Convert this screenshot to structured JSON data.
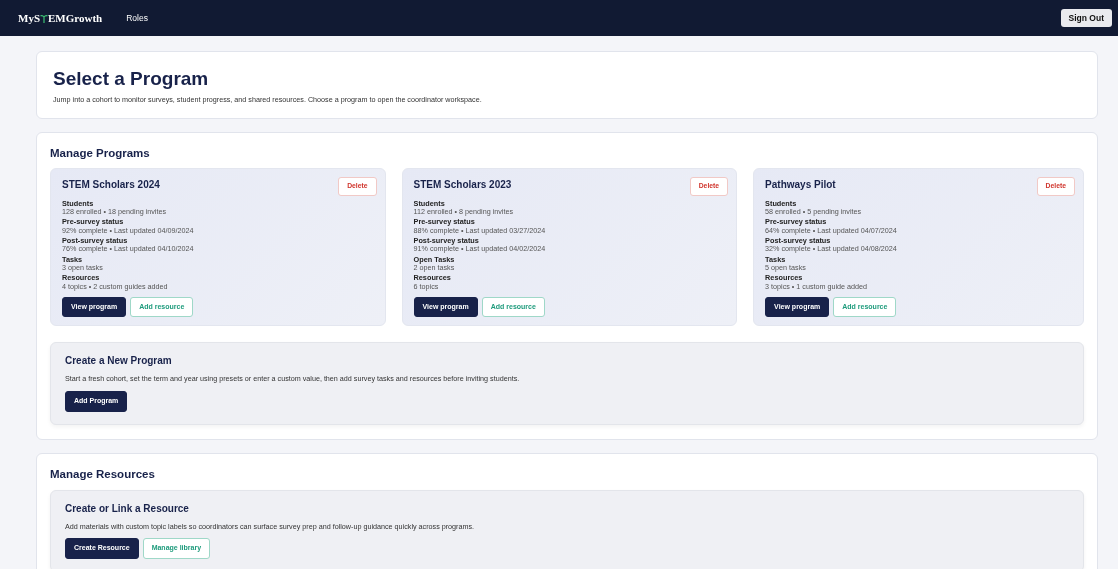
{
  "navbar": {
    "brand_start": "MyS",
    "brand_end": "EMGrowth",
    "links": [
      {
        "label": "Roles"
      }
    ],
    "sign_out": "Sign Out"
  },
  "hero": {
    "title": "Select a Program",
    "subtitle": "Jump into a cohort to monitor surveys, student progress, and shared resources. Choose a program to open the coordinator workspace."
  },
  "manage_programs": {
    "title": "Manage Programs",
    "programs": [
      {
        "name": "STEM Scholars 2024",
        "delete": "Delete",
        "fields": [
          {
            "label": "Students",
            "value": "128 enrolled • 18 pending invites"
          },
          {
            "label": "Pre-survey status",
            "value": "92% complete • Last updated 04/09/2024"
          },
          {
            "label": "Post-survey status",
            "value": "76% complete • Last updated 04/10/2024"
          },
          {
            "label": "Tasks",
            "value": "3 open tasks"
          },
          {
            "label": "Resources",
            "value": "4 topics • 2 custom guides added"
          }
        ],
        "primary": "View program",
        "secondary": "Add resource"
      },
      {
        "name": "STEM Scholars 2023",
        "delete": "Delete",
        "fields": [
          {
            "label": "Students",
            "value": "112 enrolled • 8 pending invites"
          },
          {
            "label": "Pre-survey status",
            "value": "88% complete • Last updated 03/27/2024"
          },
          {
            "label": "Post-survey status",
            "value": "91% complete • Last updated 04/02/2024"
          },
          {
            "label": "Open Tasks",
            "value": "2 open tasks"
          },
          {
            "label": "Resources",
            "value": "6 topics"
          }
        ],
        "primary": "View program",
        "secondary": "Add resource"
      },
      {
        "name": "Pathways Pilot",
        "delete": "Delete",
        "fields": [
          {
            "label": "Students",
            "value": "58 enrolled • 5 pending invites"
          },
          {
            "label": "Pre-survey status",
            "value": "64% complete • Last updated 04/07/2024"
          },
          {
            "label": "Post-survey status",
            "value": "32% complete • Last updated 04/08/2024"
          },
          {
            "label": "Tasks",
            "value": "5 open tasks"
          },
          {
            "label": "Resources",
            "value": "3 topics • 1 custom guide added"
          }
        ],
        "primary": "View program",
        "secondary": "Add resource"
      }
    ],
    "create": {
      "title": "Create a New Program",
      "text": "Start a fresh cohort, set the term and year using presets or enter a custom value, then add survey tasks and resources before inviting students.",
      "buttons": [
        {
          "label": "Add Program",
          "kind": "primary"
        }
      ]
    }
  },
  "manage_resources": {
    "title": "Manage Resources",
    "create": {
      "title": "Create or Link a Resource",
      "text": "Add materials with custom topic labels so coordinators can surface survey prep and follow-up guidance quickly across programs.",
      "buttons": [
        {
          "label": "Create Resource",
          "kind": "primary"
        },
        {
          "label": "Manage library",
          "kind": "outline"
        }
      ]
    }
  }
}
